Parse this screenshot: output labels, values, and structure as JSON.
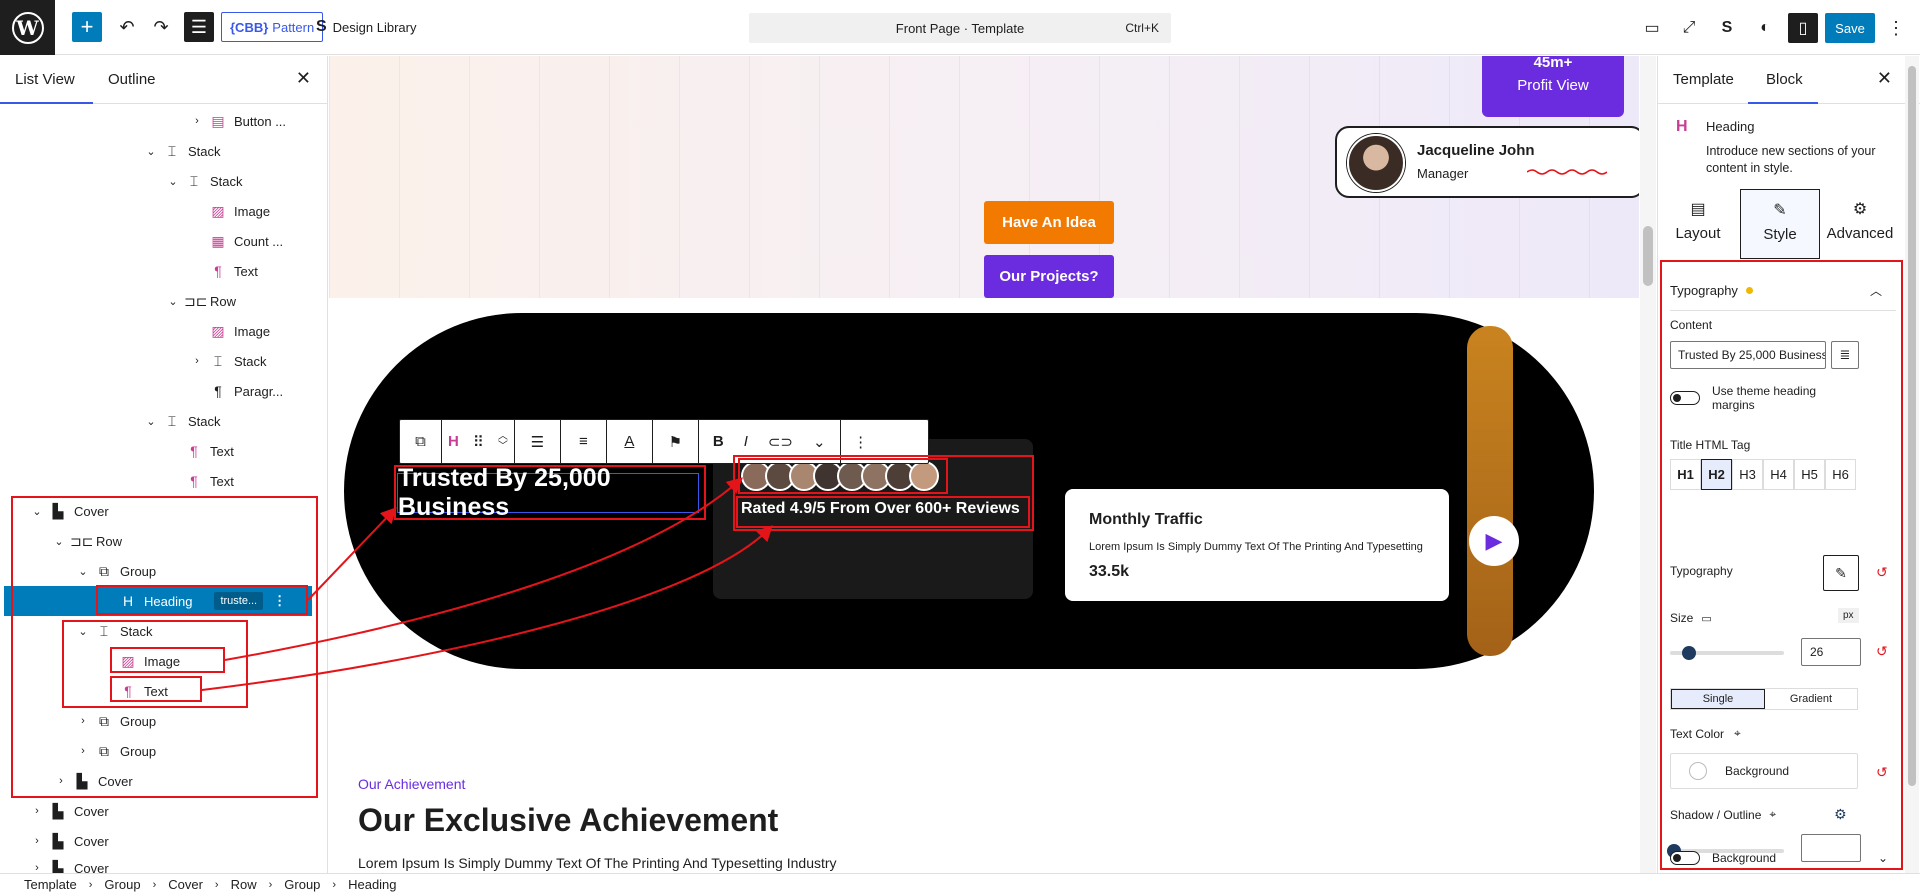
{
  "topbar": {
    "pattern_label": "Pattern",
    "pattern_prefix": "{CBB}",
    "design_library": "Design Library",
    "command_title": "Front Page · Template",
    "command_shortcut": "Ctrl+K",
    "save_label": "Save"
  },
  "left_panel": {
    "tab_list": "List View",
    "tab_outline": "Outline",
    "tree": [
      {
        "label": "Button ...",
        "icon": "button-icon"
      },
      {
        "label": "Stack",
        "icon": "stack-icon"
      },
      {
        "label": "Stack",
        "icon": "stack-icon"
      },
      {
        "label": "Image",
        "icon": "image-icon"
      },
      {
        "label": "Count ...",
        "icon": "counter-icon"
      },
      {
        "label": "Text",
        "icon": "paragraph-icon"
      },
      {
        "label": "Row",
        "icon": "row-icon"
      },
      {
        "label": "Image",
        "icon": "image-icon"
      },
      {
        "label": "Stack",
        "icon": "stack-icon"
      },
      {
        "label": "Paragr...",
        "icon": "paragraph-icon"
      },
      {
        "label": "Stack",
        "icon": "stack-icon"
      },
      {
        "label": "Text",
        "icon": "paragraph-icon"
      },
      {
        "label": "Text",
        "icon": "paragraph-icon"
      },
      {
        "label": "Cover",
        "icon": "cover-icon"
      },
      {
        "label": "Row",
        "icon": "row-icon"
      },
      {
        "label": "Group",
        "icon": "group-icon"
      },
      {
        "label": "Heading",
        "icon": "heading-icon",
        "badge": "truste..."
      },
      {
        "label": "Stack",
        "icon": "stack-icon"
      },
      {
        "label": "Image",
        "icon": "image-icon"
      },
      {
        "label": "Text",
        "icon": "paragraph-icon"
      },
      {
        "label": "Group",
        "icon": "group-icon"
      },
      {
        "label": "Group",
        "icon": "group-icon"
      },
      {
        "label": "Cover",
        "icon": "cover-icon"
      },
      {
        "label": "Cover",
        "icon": "cover-icon"
      },
      {
        "label": "Cover",
        "icon": "cover-icon"
      },
      {
        "label": "Cover",
        "icon": "cover-icon"
      }
    ]
  },
  "canvas": {
    "profit_num": "45m+",
    "profit_label": "Profit View",
    "person_name": "Jacqueline John",
    "person_role": "Manager",
    "btn_idea": "Have An Idea",
    "btn_projects": "Our Projects?",
    "heading": "Trusted By 25,000 Business",
    "rated": "Rated 4.9/5 From Over 600+ Reviews",
    "traffic_title": "Monthly Traffic",
    "traffic_text": "Lorem Ipsum Is Simply Dummy Text Of The Printing And Typesetting",
    "traffic_num": "33.5k",
    "ach_sub": "Our Achievement",
    "ach_title": "Our Exclusive Achievement",
    "ach_text": "Lorem Ipsum Is Simply Dummy Text Of The Printing And Typesetting Industry"
  },
  "right_panel": {
    "tab_template": "Template",
    "tab_block": "Block",
    "block_name": "Heading",
    "block_desc": "Introduce new sections of your content in style.",
    "tab_layout": "Layout",
    "tab_style": "Style",
    "tab_advanced": "Advanced",
    "typography_section": "Typography",
    "content_label": "Content",
    "content_value": "Trusted By 25,000 Business",
    "theme_margins": "Use theme heading margins",
    "html_tag_label": "Title HTML Tag",
    "tags": [
      "H1",
      "H2",
      "H3",
      "H4",
      "H5",
      "H6"
    ],
    "typography_label": "Typography",
    "size_label": "Size",
    "size_unit": "px",
    "size_value": "26",
    "size_fraction": 0.17,
    "single": "Single",
    "gradient": "Gradient",
    "text_color": "Text Color",
    "background_label": "Background",
    "shadow": "Shadow / Outline",
    "background_toggle": "Background"
  },
  "breadcrumb": [
    "Template",
    "Group",
    "Cover",
    "Row",
    "Group",
    "Heading"
  ],
  "colors": {
    "accent": "#007cba",
    "purple": "#6b2ce0",
    "orange": "#f27a00",
    "annotation_red": "#e3141a"
  }
}
